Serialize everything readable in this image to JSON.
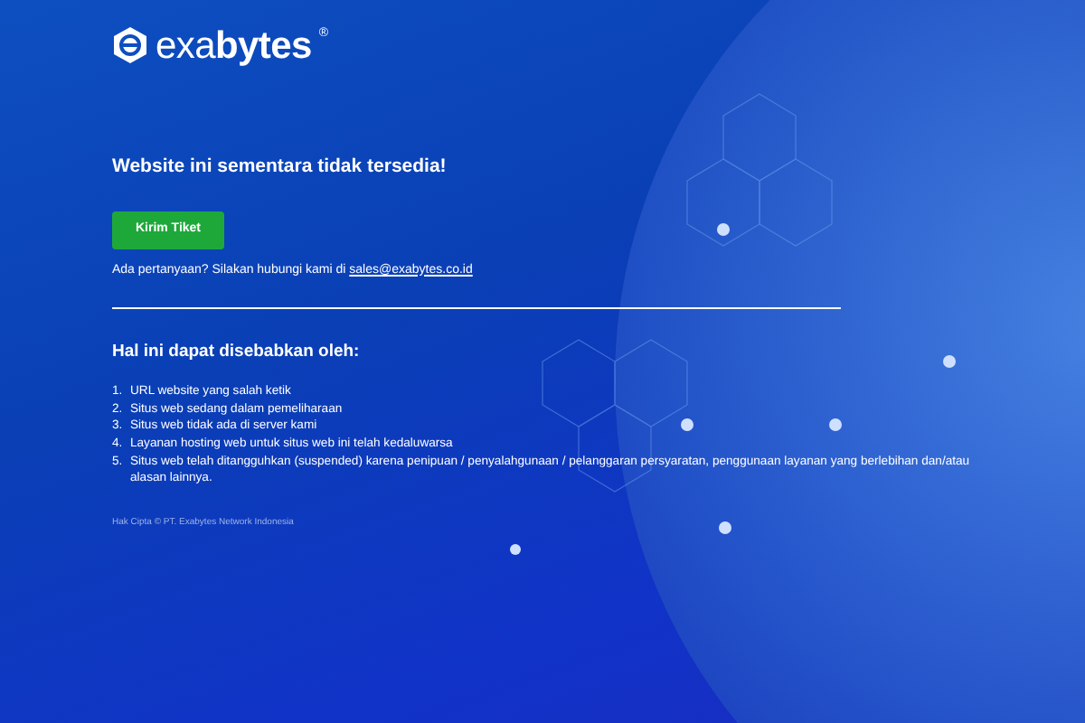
{
  "logo": {
    "text": "exa**bytes**",
    "mark": "®"
  },
  "title": "Website ini sementara tidak tersedia!",
  "button": "Kirim Tiket",
  "contact": {
    "text": "Ada pertanyaan? Silakan hubungi kami di",
    "email": "sales@exabytes.co.id"
  },
  "reasons_heading": "Hal ini dapat disebabkan oleh:",
  "reasons": [
    {
      "number": "1.",
      "text": "URL website yang salah ketik"
    },
    {
      "number": "2.",
      "text": "Situs web sedang dalam pemeliharaan"
    },
    {
      "number": "3.",
      "text": "Situs web tidak ada di server kami"
    },
    {
      "number": "4.",
      "text": "Layanan hosting web untuk situs web ini telah kedaluwarsa"
    },
    {
      "number": "5.",
      "text": "Situs web telah ditangguhkan (suspended) karena penipuan / penyalahgunaan / pelanggaran persyaratan, penggunaan layanan yang berlebihan dan/atau alasan lainnya."
    }
  ],
  "copyright": "Hak Cipta © PT. Exabytes Network Indonesia"
}
